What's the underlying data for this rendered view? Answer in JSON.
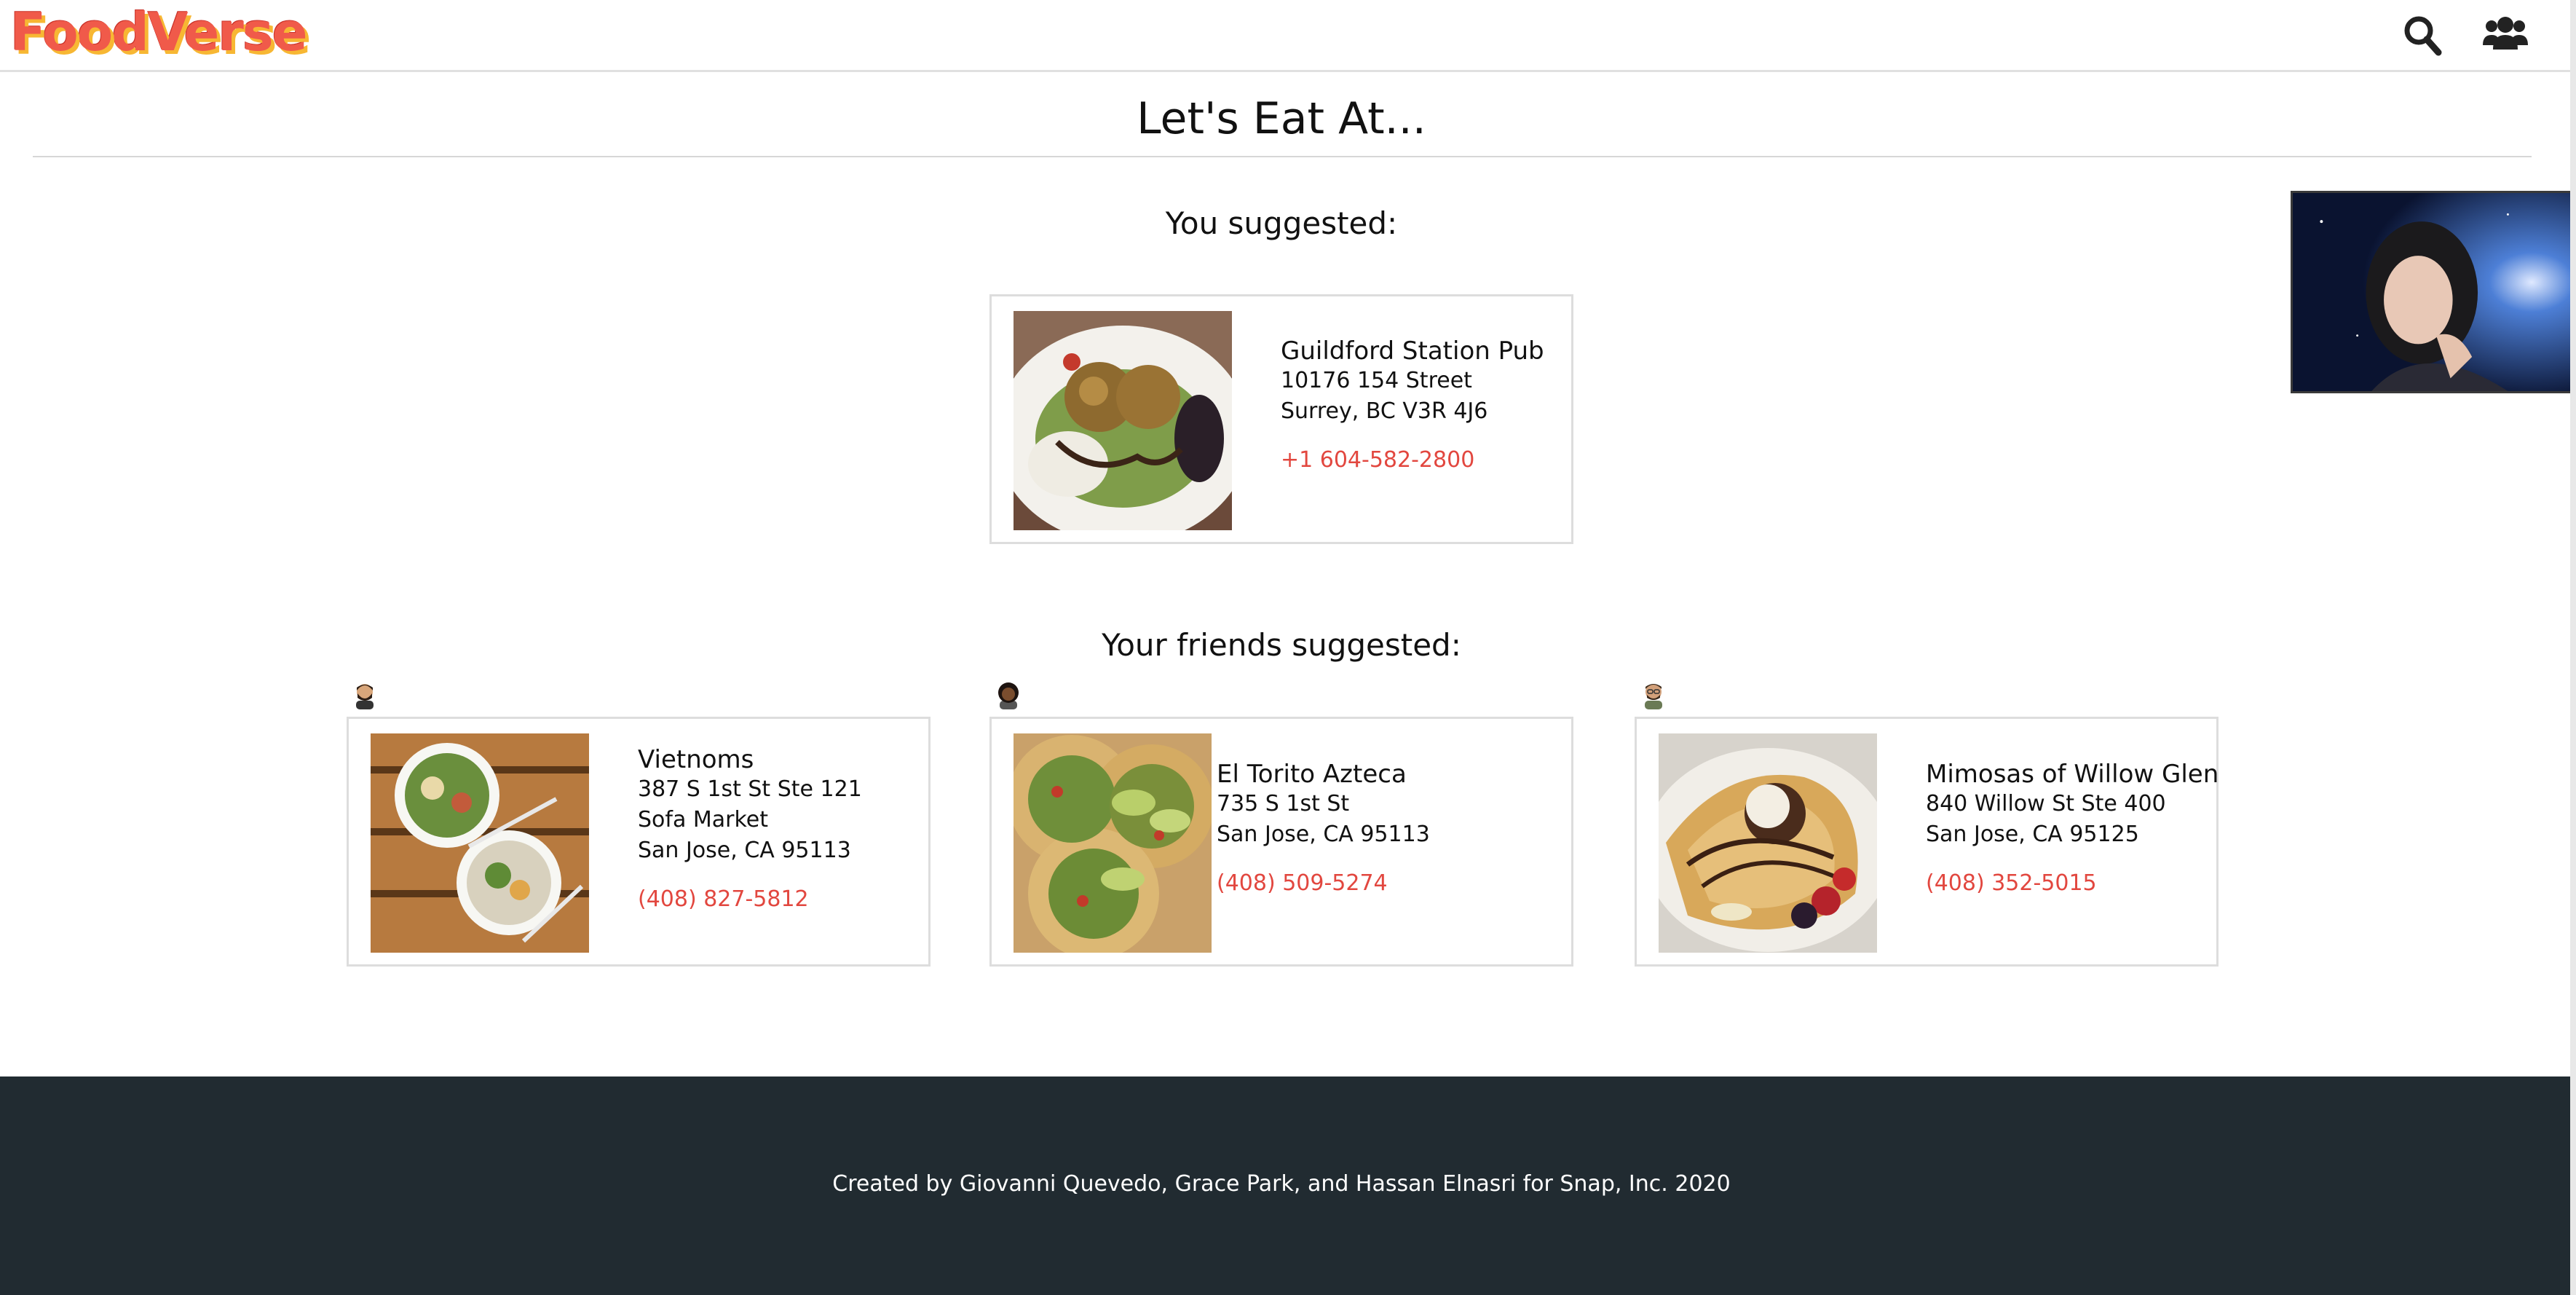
{
  "app": {
    "logo_text": "FoodVerse",
    "brand_color": "#f05a4a",
    "brand_shadow_color": "#f7b733"
  },
  "header": {
    "icons": [
      "search-icon",
      "friends-icon"
    ]
  },
  "page": {
    "title": "Let's  Eat At..."
  },
  "you_section": {
    "heading": "You suggested:",
    "card": {
      "name": "Guildford Station  Pub",
      "address": [
        "10176 154 Street",
        "Surrey,  BC V3R 4J6"
      ],
      "phone": "+1 604-582-2800"
    }
  },
  "friends_section": {
    "heading": "Your friends suggested:",
    "cards": [
      {
        "name": "Vietnoms",
        "address": [
          "387 S 1st St Ste 121",
          "Sofa  Market",
          "San Jose, CA 95113"
        ],
        "phone": "(408) 827-5812"
      },
      {
        "name": "El Torito Azteca",
        "address": [
          "735 S 1st St",
          "San Jose, CA 95113"
        ],
        "phone": "(408) 509-5274"
      },
      {
        "name": "Mimosas of Willow Glen",
        "address": [
          "840 Willow St Ste 400",
          "San Jose, CA 95125"
        ],
        "phone": "(408) 352-5015"
      }
    ]
  },
  "footer": {
    "text": "Created by Giovanni Quevedo, Grace  Park, and  Hassan  Elnasri for Snap,  Inc. 2020"
  },
  "colors": {
    "phone_link": "#e2473f",
    "footer_bg": "#212b31"
  }
}
